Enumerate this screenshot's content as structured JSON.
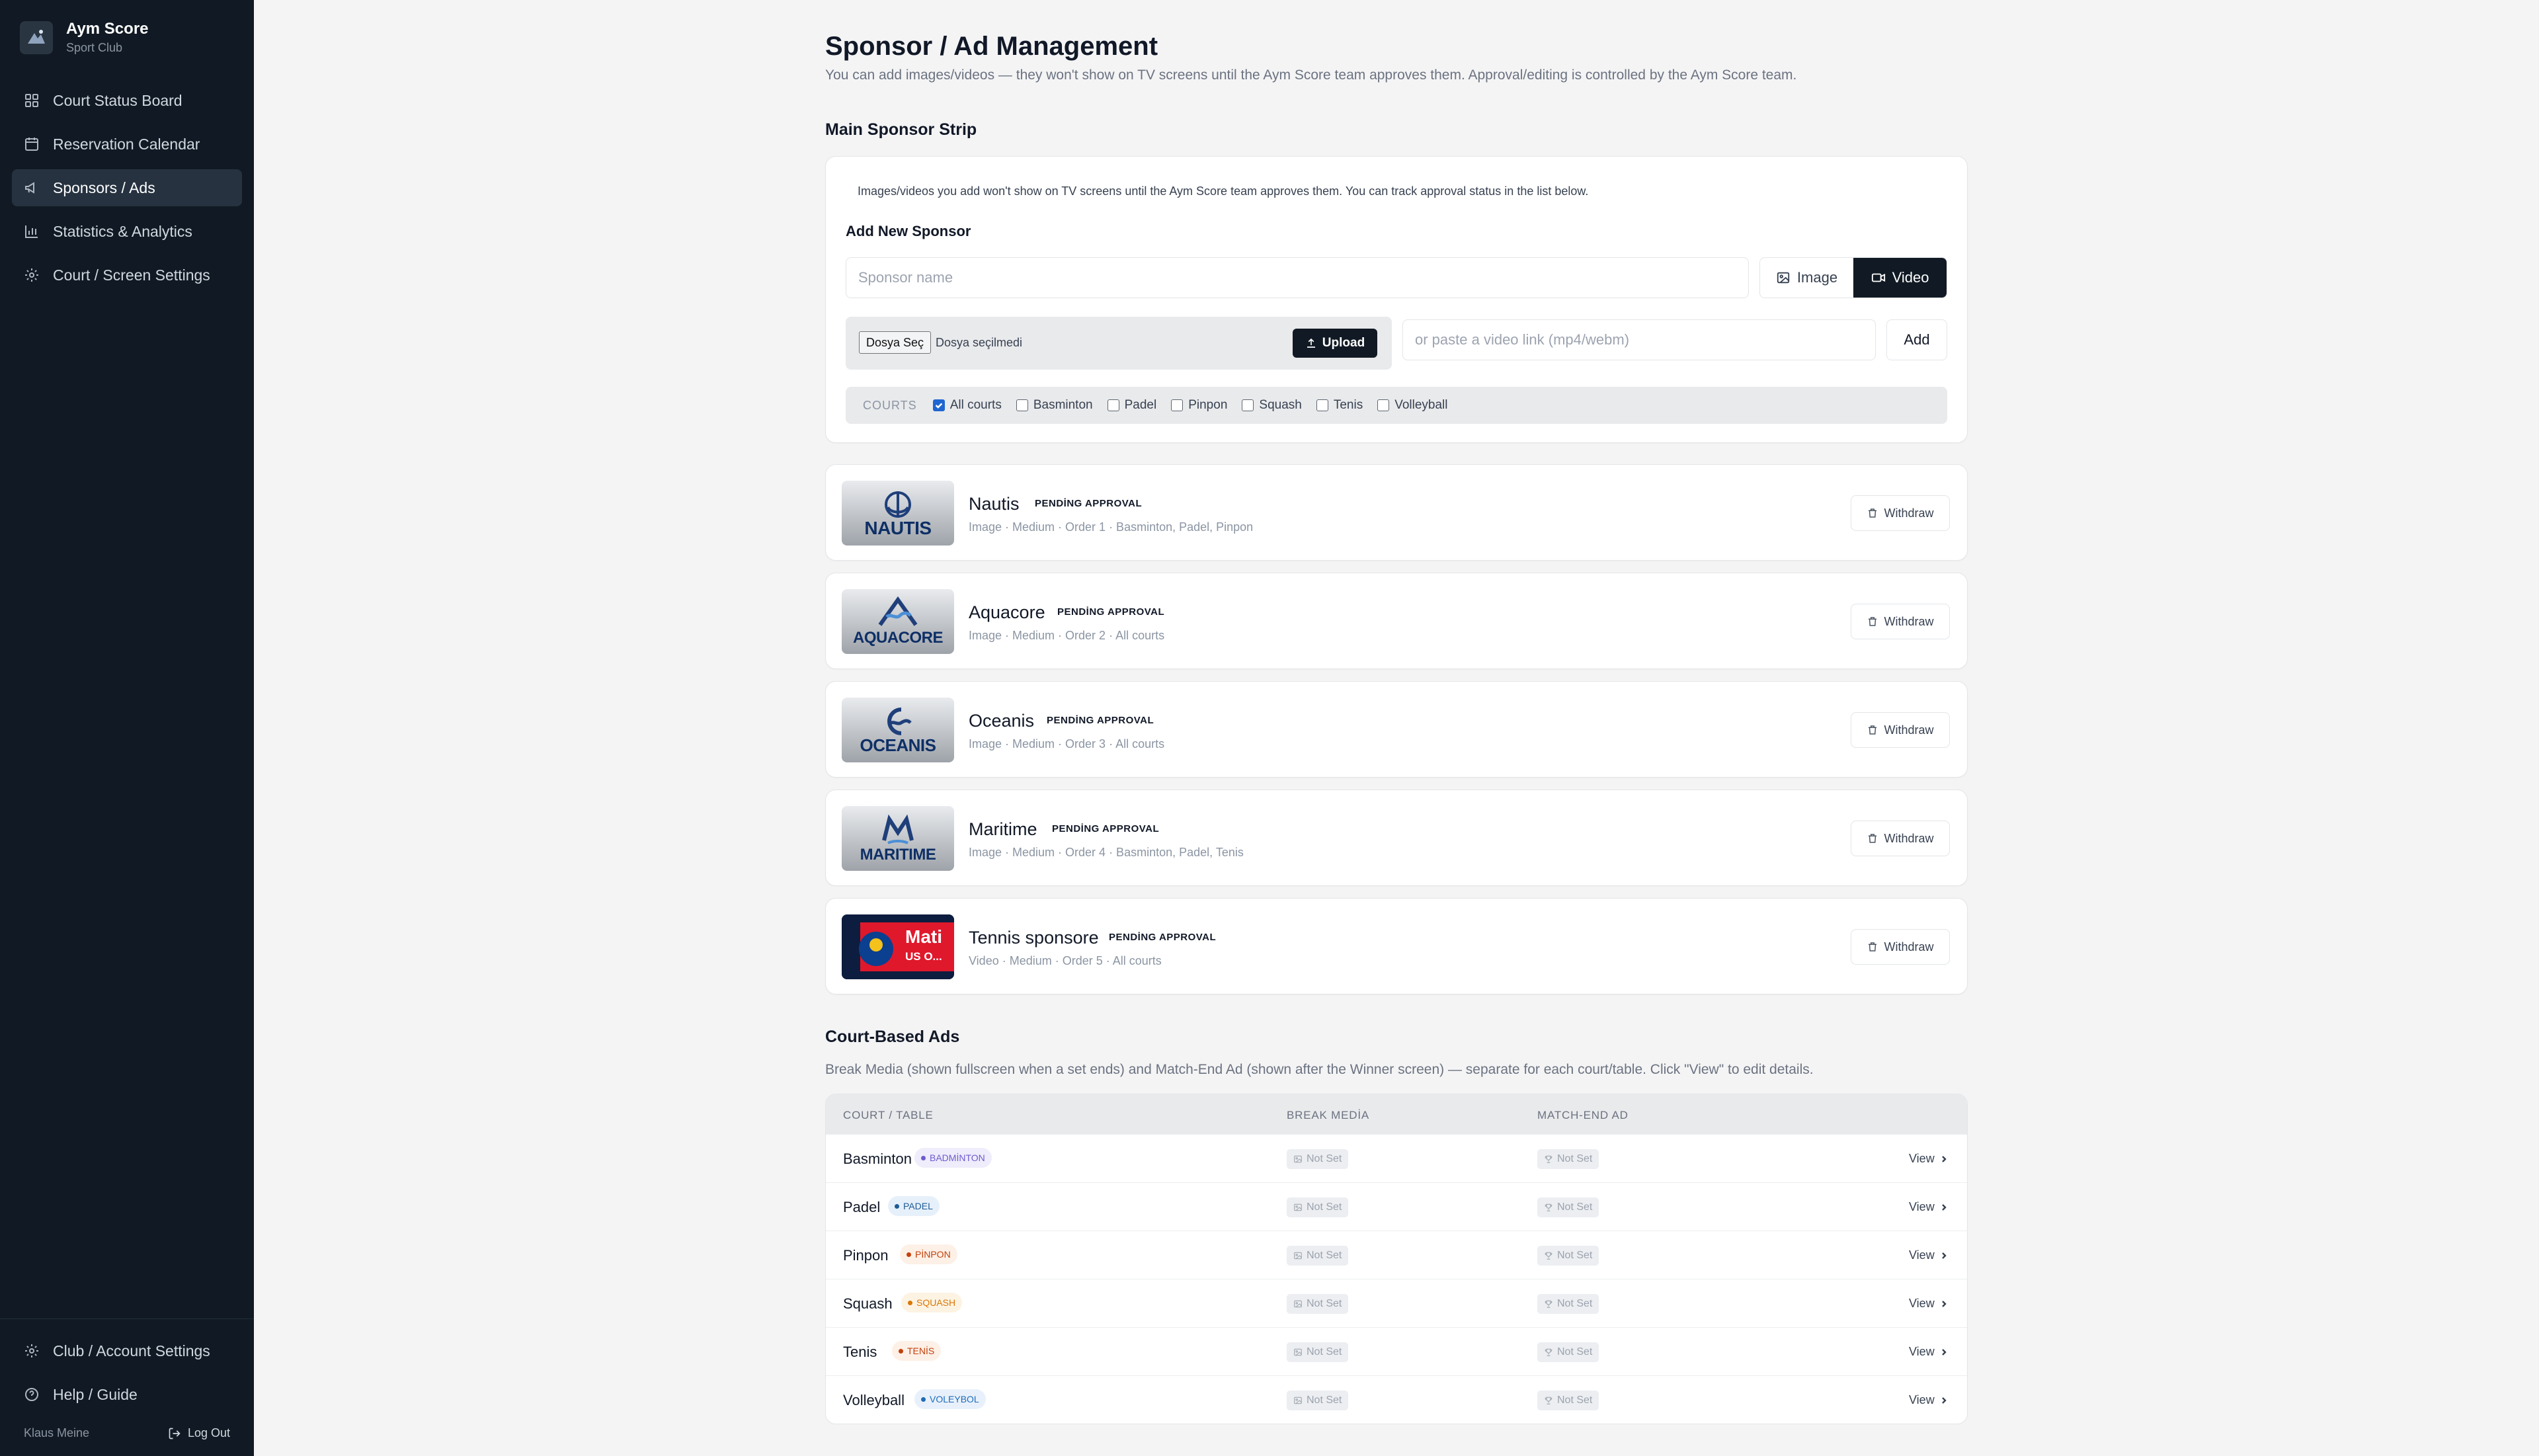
{
  "brand": {
    "name": "Aym Score",
    "subtitle": "Sport Club"
  },
  "sidebar": {
    "items": [
      {
        "label": "Court Status Board",
        "icon": "grid-icon",
        "active": false
      },
      {
        "label": "Reservation Calendar",
        "icon": "calendar-icon",
        "active": false
      },
      {
        "label": "Sponsors / Ads",
        "icon": "megaphone-icon",
        "active": true
      },
      {
        "label": "Statistics & Analytics",
        "icon": "bar-chart-icon",
        "active": false
      },
      {
        "label": "Court / Screen Settings",
        "icon": "gear-icon",
        "active": false
      }
    ],
    "bottom": [
      {
        "label": "Club / Account Settings",
        "icon": "gear-icon"
      },
      {
        "label": "Help / Guide",
        "icon": "help-icon"
      }
    ],
    "user": "Klaus Meine",
    "logout": "Log Out"
  },
  "header": {
    "title": "Sponsor / Ad Management",
    "subtitle": "You can add images/videos — they won't show on TV screens until the Aym Score team approves them. Approval/editing is controlled by the Aym Score team."
  },
  "main_strip": {
    "title": "Main Sponsor Strip",
    "note": "Images/videos you add won't show on TV screens until the Aym Score team approves them. You can track approval status in the list below.",
    "add_title": "Add New Sponsor",
    "name_placeholder": "Sponsor name",
    "image_label": "Image",
    "video_label": "Video",
    "media_selected": "video",
    "file_button": "Dosya Seç",
    "file_status": "Dosya seçilmedi",
    "upload_label": "Upload",
    "link_placeholder": "or paste a video link (mp4/webm)",
    "add_label": "Add",
    "courts_label": "COURTS",
    "courts": [
      {
        "label": "All courts",
        "checked": true
      },
      {
        "label": "Basminton",
        "checked": false
      },
      {
        "label": "Padel",
        "checked": false
      },
      {
        "label": "Pinpon",
        "checked": false
      },
      {
        "label": "Squash",
        "checked": false
      },
      {
        "label": "Tenis",
        "checked": false
      },
      {
        "label": "Volleyball",
        "checked": false
      }
    ]
  },
  "sponsors": [
    {
      "name": "Nautis",
      "status": "PENDİNG APPROVAL",
      "meta": "Image · Medium · Order 1 · Basminton, Padel, Pinpon",
      "thumb_text": "NAUTIS",
      "withdraw": "Withdraw"
    },
    {
      "name": "Aquacore",
      "status": "PENDİNG APPROVAL",
      "meta": "Image · Medium · Order 2 · All courts",
      "thumb_text": "AQUACORE",
      "withdraw": "Withdraw"
    },
    {
      "name": "Oceanis",
      "status": "PENDİNG APPROVAL",
      "meta": "Image · Medium · Order 3 · All courts",
      "thumb_text": "OCEANIS",
      "withdraw": "Withdraw"
    },
    {
      "name": "Maritime",
      "status": "PENDİNG APPROVAL",
      "meta": "Image · Medium · Order 4 · Basminton, Padel, Tenis",
      "thumb_text": "MARITIME",
      "withdraw": "Withdraw"
    },
    {
      "name": "Tennis sponsore",
      "status": "PENDİNG APPROVAL",
      "meta": "Video · Medium · Order 5 · All courts",
      "thumb_text": "Mati",
      "thumb_text_2": "US O...",
      "withdraw": "Withdraw"
    }
  ],
  "court_ads": {
    "title": "Court-Based Ads",
    "subtitle": "Break Media (shown fullscreen when a set ends) and Match-End Ad (shown after the Winner screen) — separate for each court/table. Click \"View\" to edit details.",
    "columns": [
      "COURT / TABLE",
      "BREAK MEDİA",
      "MATCH-END AD"
    ],
    "rows": [
      {
        "court": "Basminton",
        "tag": "BADMİNTON",
        "tag_color": "#6d5bd0",
        "tag_bg": "#efecfb",
        "break": "Not Set",
        "match_end": "Not Set",
        "view": "View"
      },
      {
        "court": "Padel",
        "tag": "PADEL",
        "tag_color": "#1e5a96",
        "tag_bg": "#e6f0fa",
        "break": "Not Set",
        "match_end": "Not Set",
        "view": "View"
      },
      {
        "court": "Pinpon",
        "tag": "PİNPON",
        "tag_color": "#c2410c",
        "tag_bg": "#fdf0e6",
        "break": "Not Set",
        "match_end": "Not Set",
        "view": "View"
      },
      {
        "court": "Squash",
        "tag": "SQUASH",
        "tag_color": "#d97706",
        "tag_bg": "#fdf3e3",
        "break": "Not Set",
        "match_end": "Not Set",
        "view": "View"
      },
      {
        "court": "Tenis",
        "tag": "TENİS",
        "tag_color": "#c2410c",
        "tag_bg": "#fdf0e6",
        "break": "Not Set",
        "match_end": "Not Set",
        "view": "View"
      },
      {
        "court": "Volleyball",
        "tag": "VOLEYBOL",
        "tag_color": "#1e6bb8",
        "tag_bg": "#e8f1fb",
        "break": "Not Set",
        "match_end": "Not Set",
        "view": "View"
      }
    ]
  }
}
